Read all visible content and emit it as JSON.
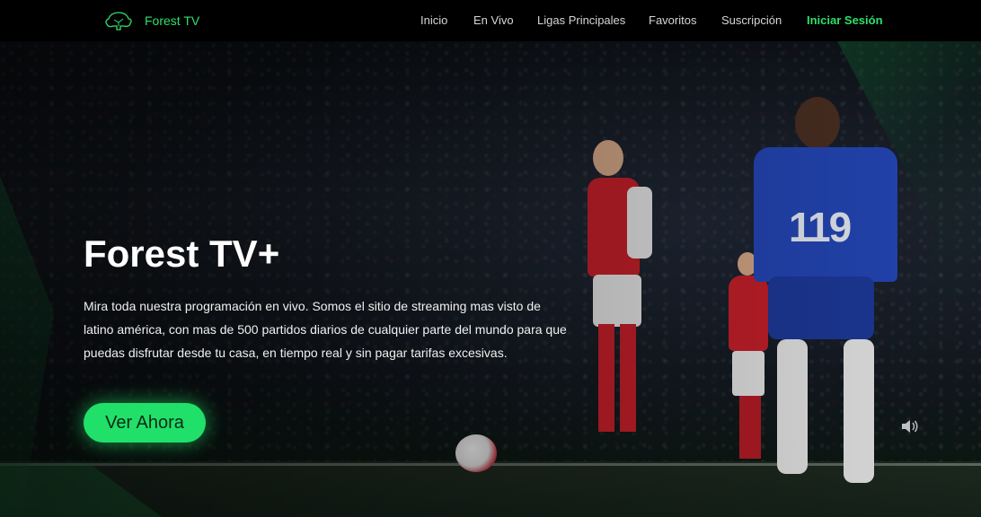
{
  "brand": {
    "name": "Forest TV",
    "icon": "tree-icon"
  },
  "nav": {
    "items": [
      {
        "label": "Inicio"
      },
      {
        "label": "En Vivo"
      },
      {
        "label": "Ligas Principales"
      },
      {
        "label": "Favoritos"
      },
      {
        "label": "Suscripción"
      }
    ],
    "login_label": "Iniciar Sesión"
  },
  "hero": {
    "title": "Forest TV+",
    "description": "Mira toda nuestra programación en vivo. Somos el sitio de streaming mas visto de latino américa, con mas de 500 partidos diarios de cualquier parte del mundo para que puedas disfrutar desde tu casa, en tiempo real y sin pagar tarifas excesivas.",
    "cta_label": "Ver Ahora",
    "shirt_number": "119",
    "volume_icon": "volume-icon"
  },
  "colors": {
    "accent": "#2ee06b",
    "cta": "#20e06a",
    "background": "#000000"
  }
}
